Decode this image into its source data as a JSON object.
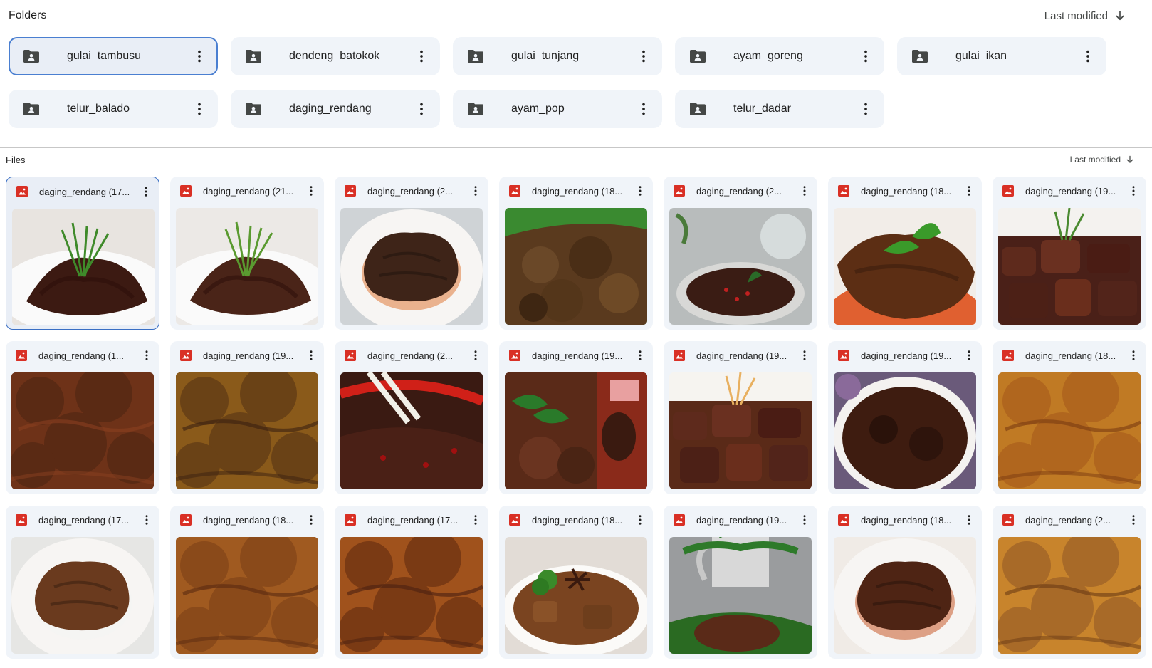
{
  "folders_section": {
    "title": "Folders",
    "sort_label": "Last modified",
    "items": [
      {
        "name": "gulai_tambusu",
        "selected": true
      },
      {
        "name": "dendeng_batokok"
      },
      {
        "name": "gulai_tunjang"
      },
      {
        "name": "ayam_goreng"
      },
      {
        "name": "gulai_ikan"
      },
      {
        "name": "telur_balado"
      },
      {
        "name": "daging_rendang"
      },
      {
        "name": "ayam_pop"
      },
      {
        "name": "telur_dadar"
      }
    ]
  },
  "files_section": {
    "title": "Files",
    "sort_label": "Last modified",
    "items": [
      {
        "name": "daging_rendang (17...",
        "selected": true,
        "thumb": "white-bowl-garnish",
        "bg": "#e8e4e0",
        "food": "#3c1a12",
        "accent": "#3f8a2a"
      },
      {
        "name": "daging_rendang (21...",
        "thumb": "white-bowl-garnish",
        "bg": "#ece9e6",
        "food": "#4a2418",
        "accent": "#5a9a30"
      },
      {
        "name": "daging_rendang (2...",
        "thumb": "plate",
        "bg": "#cfd3d6",
        "food": "#3e2418",
        "accent": "#e07a3a"
      },
      {
        "name": "daging_rendang (18...",
        "thumb": "leaf",
        "bg": "#2e6e2a",
        "food": "#5a3a1e",
        "accent": "#3a8a30"
      },
      {
        "name": "daging_rendang (2...",
        "thumb": "pot",
        "bg": "#b8bcbc",
        "food": "#3a1c14",
        "accent": "#2a6a28"
      },
      {
        "name": "daging_rendang (18...",
        "thumb": "plate-leaf",
        "bg": "#f2ede8",
        "food": "#5c2e14",
        "accent": "#3a9a2a"
      },
      {
        "name": "daging_rendang (19...",
        "thumb": "chunks",
        "bg": "#f4f2ef",
        "food": "#4a2018",
        "accent": "#4a8a30"
      },
      {
        "name": "daging_rendang (1...",
        "thumb": "closeup",
        "bg": "#5a2a14",
        "food": "#6e3218",
        "accent": "#8a4020"
      },
      {
        "name": "daging_rendang (19...",
        "thumb": "closeup",
        "bg": "#6a4216",
        "food": "#8a5a1a",
        "accent": "#3a2010"
      },
      {
        "name": "daging_rendang (2...",
        "thumb": "chili",
        "bg": "#3a1a12",
        "food": "#4a2016",
        "accent": "#d02018"
      },
      {
        "name": "daging_rendang (19...",
        "thumb": "package",
        "bg": "#8a2a1a",
        "food": "#5a2a18",
        "accent": "#2a7a2a"
      },
      {
        "name": "daging_rendang (19...",
        "thumb": "chunks",
        "bg": "#f6f4f0",
        "food": "#5a2a18",
        "accent": "#e8b060"
      },
      {
        "name": "daging_rendang (19...",
        "thumb": "bowl-dark",
        "bg": "#6a5a7a",
        "food": "#3e1c10",
        "accent": "#8a6a9a"
      },
      {
        "name": "daging_rendang (18...",
        "thumb": "closeup",
        "bg": "#b0661e",
        "food": "#c07a24",
        "accent": "#7a3a10"
      },
      {
        "name": "daging_rendang (17...",
        "thumb": "plate",
        "bg": "#e6e6e4",
        "food": "#6a3a1e",
        "accent": "#f4f4f2"
      },
      {
        "name": "daging_rendang (18...",
        "thumb": "closeup",
        "bg": "#8a4a1a",
        "food": "#a05a20",
        "accent": "#5a2a10"
      },
      {
        "name": "daging_rendang (17...",
        "thumb": "closeup",
        "bg": "#7a3a14",
        "food": "#a0521c",
        "accent": "#4a2010"
      },
      {
        "name": "daging_rendang (18...",
        "thumb": "bowl-garnish",
        "bg": "#e2dcd6",
        "food": "#7a4420",
        "accent": "#3a8a2a"
      },
      {
        "name": "daging_rendang (19...",
        "thumb": "mug",
        "bg": "#9a9c9e",
        "food": "#5a2a18",
        "accent": "#2e7a2a"
      },
      {
        "name": "daging_rendang (18...",
        "thumb": "plate",
        "bg": "#f0ebe6",
        "food": "#4e2414",
        "accent": "#c85a2a"
      },
      {
        "name": "daging_rendang (2...",
        "thumb": "closeup",
        "bg": "#a86a28",
        "food": "#c8842c",
        "accent": "#6a3a14"
      }
    ]
  }
}
